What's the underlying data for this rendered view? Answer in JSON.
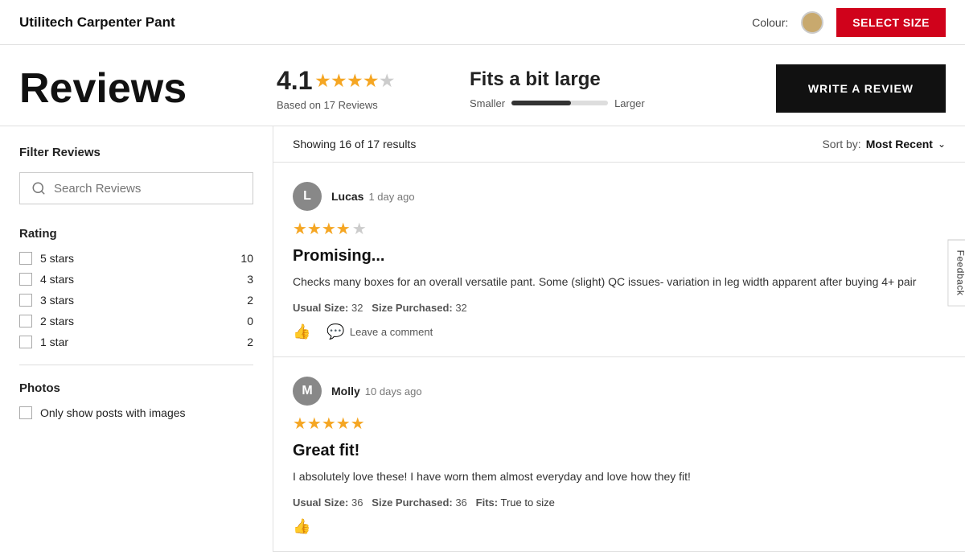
{
  "header": {
    "title": "Utilitech Carpenter Pant",
    "colour_label": "Colour:",
    "colour_swatch_bg": "#c8a96e",
    "select_size_label": "SELECT SIZE"
  },
  "reviews_section": {
    "heading": "Reviews",
    "rating": {
      "value": "4.1",
      "based_on": "Based on 17 Reviews",
      "stars_filled": 4,
      "stars_half": 0,
      "stars_empty": 1
    },
    "fit": {
      "title": "Fits a bit large",
      "smaller_label": "Smaller",
      "larger_label": "Larger",
      "bar_position_pct": 62
    },
    "write_review_label": "WRITE A REVIEW"
  },
  "filter": {
    "label": "Filter Reviews",
    "search_placeholder": "Search Reviews",
    "rating_label": "Rating",
    "ratings": [
      {
        "stars": 5,
        "label": "5 stars",
        "count": 10
      },
      {
        "stars": 4,
        "label": "4 stars",
        "count": 3
      },
      {
        "stars": 3,
        "label": "3 stars",
        "count": 2
      },
      {
        "stars": 2,
        "label": "2 stars",
        "count": 0
      },
      {
        "stars": 1,
        "label": "1 star",
        "count": 2
      }
    ],
    "photos_label": "Photos",
    "photos_filter_label": "Only show posts with images"
  },
  "results": {
    "showing_text": "Showing 16 of 17 results",
    "sort_label": "Sort by:",
    "sort_value": "Most Recent"
  },
  "reviews": [
    {
      "id": 1,
      "author": "Lucas",
      "avatar_letter": "L",
      "avatar_bg": "#888",
      "time_ago": "1 day ago",
      "stars_filled": 4,
      "stars_empty": 1,
      "title": "Promising...",
      "body": "Checks many boxes for an overall versatile pant. Some (slight) QC issues- variation in leg width apparent after buying 4+ pair",
      "usual_size": "32",
      "size_purchased": "32",
      "fits_text": null,
      "thumbs_label": "",
      "comment_label": "Leave a comment"
    },
    {
      "id": 2,
      "author": "Molly",
      "avatar_letter": "M",
      "avatar_bg": "#888",
      "time_ago": "10 days ago",
      "stars_filled": 5,
      "stars_empty": 0,
      "title": "Great fit!",
      "body": "I absolutely love these! I have worn them almost everyday and love how they fit!",
      "usual_size": "36",
      "size_purchased": "36",
      "fits_text": "True to size",
      "thumbs_label": "",
      "comment_label": ""
    }
  ],
  "feedback": {
    "label": "Feedback"
  }
}
